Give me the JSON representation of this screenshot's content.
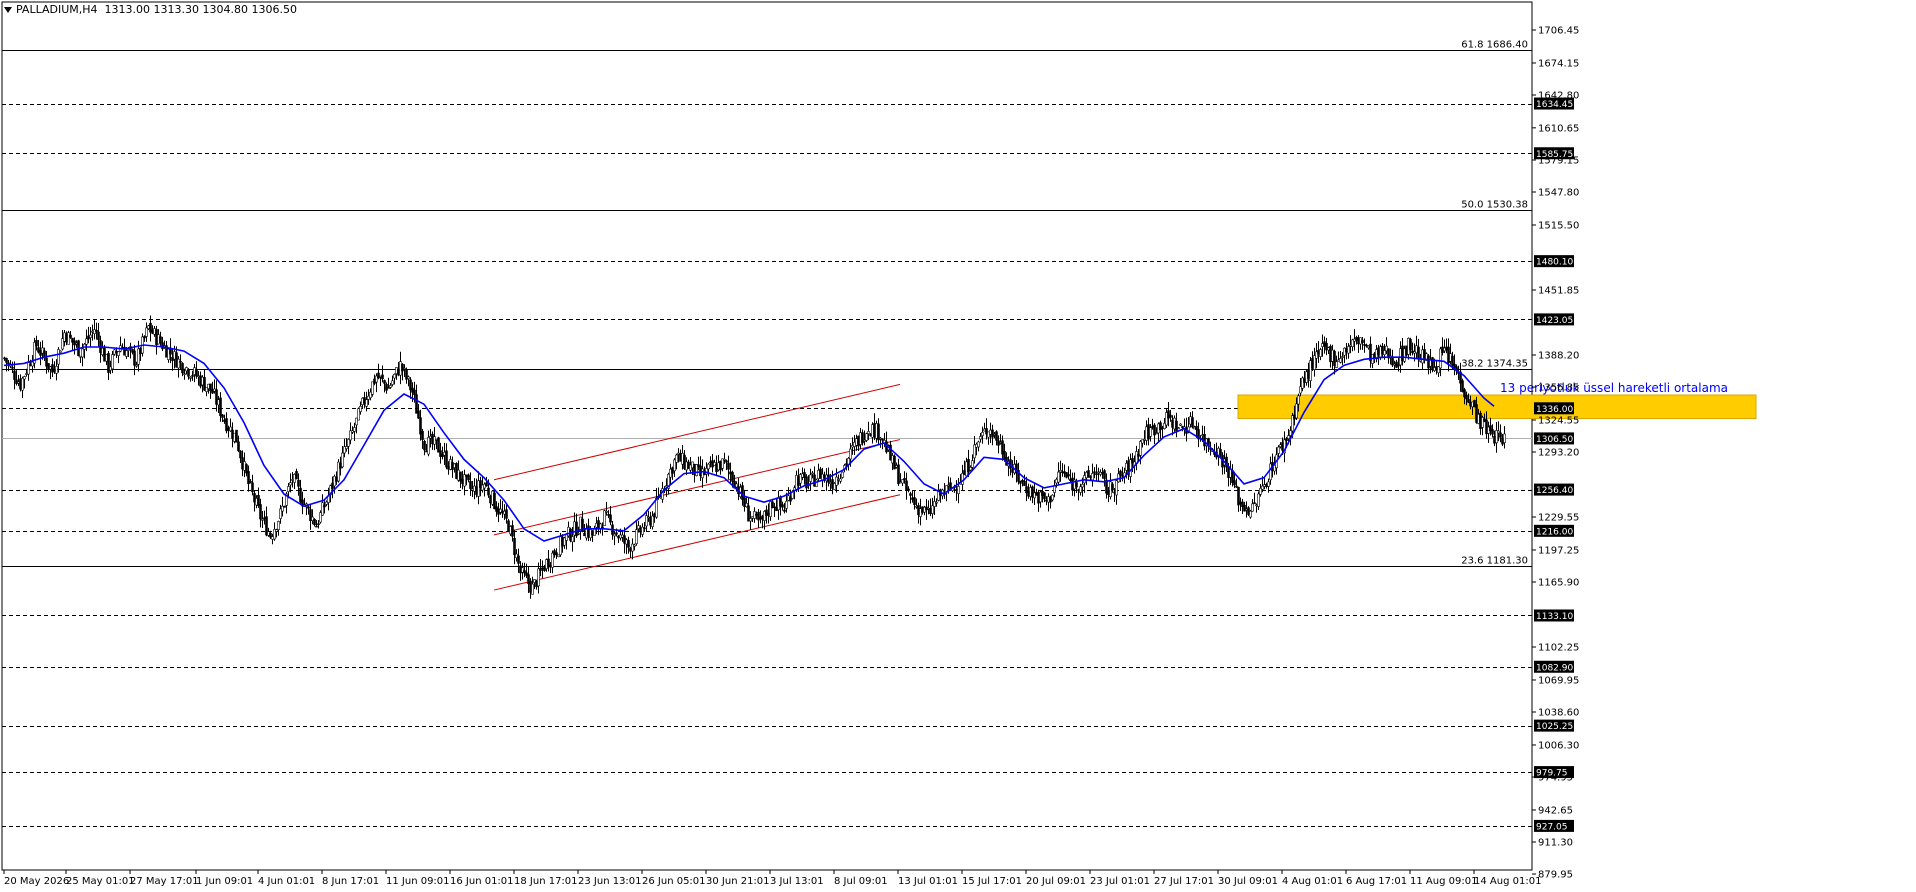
{
  "header": {
    "symbol": "PALLADIUM,H4",
    "ohlc": "1313.00 1313.30 1304.80 1306.50"
  },
  "colors": {
    "background": "#ffffff",
    "candle": "#000000",
    "ema": "#0000ff",
    "channel": "#cc0000",
    "zone": "#ffcc00",
    "level": "#000000",
    "label_box": "#000000",
    "label_text": "#ffffff"
  },
  "chart_data": {
    "type": "candlestick",
    "symbol": "PALLADIUM",
    "timeframe": "H4",
    "y_range": [
      879.95,
      1706.45
    ],
    "x_labels": [
      "20 May 2026",
      "25 May 01:01",
      "27 May 17:01",
      "1 Jun 09:01",
      "4 Jun 01:01",
      "8 Jun 17:01",
      "11 Jun 09:01",
      "16 Jun 01:01",
      "18 Jun 17:01",
      "23 Jun 13:01",
      "26 Jun 05:01",
      "30 Jun 21:01",
      "3 Jul 13:01",
      "8 Jul 09:01",
      "13 Jul 01:01",
      "15 Jul 17:01",
      "20 Jul 09:01",
      "23 Jul 01:01",
      "27 Jul 17:01",
      "30 Jul 09:01",
      "4 Aug 01:01",
      "6 Aug 17:01",
      "11 Aug 09:01",
      "14 Aug 01:01"
    ],
    "y_ticks": [
      "1706.45",
      "1674.15",
      "1642.80",
      "1610.65",
      "1579.15",
      "1547.80",
      "1515.50",
      "1451.85",
      "1388.20",
      "1356.85",
      "1324.55",
      "1293.20",
      "1229.55",
      "1197.25",
      "1165.90",
      "1102.25",
      "1069.95",
      "1038.60",
      "1006.30",
      "974.95",
      "942.65",
      "911.30",
      "879.95"
    ],
    "horizontal_levels": [
      "1634.45",
      "1585.75",
      "1480.10",
      "1423.05",
      "1336.00",
      "1256.40",
      "1216.00",
      "1133.10",
      "1082.90",
      "1025.25",
      "979.75",
      "927.05"
    ],
    "current_price": "1306.50",
    "fibonacci": [
      {
        "ratio": "61.8",
        "price": "1686.40"
      },
      {
        "ratio": "50.0",
        "price": "1530.38"
      },
      {
        "ratio": "38.2",
        "price": "1374.35"
      },
      {
        "ratio": "23.6",
        "price": "1181.30"
      }
    ],
    "ema_label": "13 periyotluk üssel hareketli ortalama",
    "zone": [
      1326,
      1349
    ],
    "price_path": [
      [
        0,
        1385
      ],
      [
        8,
        1360
      ],
      [
        16,
        1398
      ],
      [
        24,
        1372
      ],
      [
        30,
        1410
      ],
      [
        38,
        1392
      ],
      [
        45,
        1414
      ],
      [
        52,
        1376
      ],
      [
        58,
        1398
      ],
      [
        66,
        1382
      ],
      [
        72,
        1415
      ],
      [
        80,
        1396
      ],
      [
        88,
        1380
      ],
      [
        96,
        1368
      ],
      [
        104,
        1352
      ],
      [
        110,
        1325
      ],
      [
        116,
        1306
      ],
      [
        122,
        1262
      ],
      [
        128,
        1230
      ],
      [
        133,
        1212
      ],
      [
        138,
        1232
      ],
      [
        144,
        1268
      ],
      [
        150,
        1242
      ],
      [
        156,
        1222
      ],
      [
        162,
        1250
      ],
      [
        168,
        1283
      ],
      [
        174,
        1312
      ],
      [
        180,
        1344
      ],
      [
        186,
        1368
      ],
      [
        192,
        1356
      ],
      [
        198,
        1378
      ],
      [
        204,
        1352
      ],
      [
        210,
        1302
      ],
      [
        216,
        1300
      ],
      [
        222,
        1282
      ],
      [
        228,
        1268
      ],
      [
        234,
        1255
      ],
      [
        240,
        1262
      ],
      [
        246,
        1240
      ],
      [
        252,
        1222
      ],
      [
        258,
        1175
      ],
      [
        264,
        1160
      ],
      [
        270,
        1182
      ],
      [
        276,
        1198
      ],
      [
        282,
        1212
      ],
      [
        288,
        1222
      ],
      [
        294,
        1212
      ],
      [
        300,
        1230
      ],
      [
        306,
        1214
      ],
      [
        312,
        1200
      ],
      [
        318,
        1216
      ],
      [
        324,
        1230
      ],
      [
        330,
        1262
      ],
      [
        336,
        1288
      ],
      [
        342,
        1280
      ],
      [
        348,
        1270
      ],
      [
        354,
        1278
      ],
      [
        360,
        1282
      ],
      [
        366,
        1262
      ],
      [
        372,
        1232
      ],
      [
        378,
        1222
      ],
      [
        384,
        1244
      ],
      [
        390,
        1238
      ],
      [
        396,
        1268
      ],
      [
        402,
        1262
      ],
      [
        408,
        1272
      ],
      [
        414,
        1264
      ],
      [
        420,
        1280
      ],
      [
        426,
        1302
      ],
      [
        432,
        1318
      ],
      [
        438,
        1312
      ],
      [
        444,
        1282
      ],
      [
        450,
        1258
      ],
      [
        456,
        1240
      ],
      [
        462,
        1232
      ],
      [
        468,
        1252
      ],
      [
        474,
        1258
      ],
      [
        480,
        1272
      ],
      [
        486,
        1300
      ],
      [
        492,
        1318
      ],
      [
        498,
        1300
      ],
      [
        504,
        1276
      ],
      [
        510,
        1260
      ],
      [
        516,
        1250
      ],
      [
        522,
        1245
      ],
      [
        528,
        1275
      ],
      [
        534,
        1262
      ],
      [
        540,
        1264
      ],
      [
        546,
        1276
      ],
      [
        552,
        1254
      ],
      [
        558,
        1268
      ],
      [
        564,
        1282
      ],
      [
        570,
        1310
      ],
      [
        576,
        1318
      ],
      [
        582,
        1326
      ],
      [
        588,
        1316
      ],
      [
        594,
        1322
      ],
      [
        600,
        1304
      ],
      [
        606,
        1296
      ],
      [
        612,
        1276
      ],
      [
        618,
        1242
      ],
      [
        624,
        1236
      ],
      [
        630,
        1262
      ],
      [
        636,
        1290
      ],
      [
        642,
        1310
      ],
      [
        648,
        1356
      ],
      [
        654,
        1380
      ],
      [
        660,
        1394
      ],
      [
        666,
        1384
      ],
      [
        672,
        1396
      ],
      [
        678,
        1404
      ],
      [
        684,
        1384
      ],
      [
        690,
        1392
      ],
      [
        696,
        1382
      ],
      [
        702,
        1398
      ],
      [
        708,
        1388
      ],
      [
        714,
        1376
      ],
      [
        720,
        1392
      ],
      [
        726,
        1372
      ],
      [
        732,
        1346
      ],
      [
        738,
        1322
      ],
      [
        744,
        1310
      ],
      [
        750,
        1306
      ]
    ],
    "ema_path": [
      [
        0,
        1378
      ],
      [
        10,
        1380
      ],
      [
        20,
        1386
      ],
      [
        30,
        1390
      ],
      [
        40,
        1396
      ],
      [
        50,
        1396
      ],
      [
        60,
        1394
      ],
      [
        70,
        1398
      ],
      [
        80,
        1396
      ],
      [
        90,
        1392
      ],
      [
        100,
        1380
      ],
      [
        110,
        1356
      ],
      [
        120,
        1322
      ],
      [
        130,
        1280
      ],
      [
        140,
        1252
      ],
      [
        150,
        1240
      ],
      [
        160,
        1246
      ],
      [
        170,
        1266
      ],
      [
        180,
        1300
      ],
      [
        190,
        1334
      ],
      [
        200,
        1350
      ],
      [
        210,
        1340
      ],
      [
        220,
        1312
      ],
      [
        230,
        1286
      ],
      [
        240,
        1268
      ],
      [
        250,
        1246
      ],
      [
        260,
        1218
      ],
      [
        270,
        1206
      ],
      [
        280,
        1212
      ],
      [
        290,
        1218
      ],
      [
        300,
        1218
      ],
      [
        310,
        1216
      ],
      [
        320,
        1232
      ],
      [
        330,
        1256
      ],
      [
        340,
        1272
      ],
      [
        350,
        1274
      ],
      [
        360,
        1268
      ],
      [
        370,
        1250
      ],
      [
        380,
        1244
      ],
      [
        390,
        1250
      ],
      [
        400,
        1260
      ],
      [
        410,
        1266
      ],
      [
        420,
        1276
      ],
      [
        430,
        1296
      ],
      [
        440,
        1302
      ],
      [
        450,
        1284
      ],
      [
        460,
        1262
      ],
      [
        470,
        1252
      ],
      [
        480,
        1266
      ],
      [
        490,
        1288
      ],
      [
        500,
        1286
      ],
      [
        510,
        1268
      ],
      [
        520,
        1258
      ],
      [
        530,
        1262
      ],
      [
        540,
        1266
      ],
      [
        550,
        1264
      ],
      [
        560,
        1268
      ],
      [
        570,
        1290
      ],
      [
        580,
        1308
      ],
      [
        590,
        1316
      ],
      [
        600,
        1304
      ],
      [
        610,
        1284
      ],
      [
        620,
        1262
      ],
      [
        630,
        1268
      ],
      [
        640,
        1294
      ],
      [
        650,
        1332
      ],
      [
        660,
        1364
      ],
      [
        670,
        1378
      ],
      [
        680,
        1384
      ],
      [
        690,
        1386
      ],
      [
        700,
        1386
      ],
      [
        710,
        1384
      ],
      [
        720,
        1382
      ],
      [
        730,
        1368
      ],
      [
        740,
        1346
      ],
      [
        745,
        1338
      ]
    ],
    "channel": {
      "start_index": 245,
      "end_index": 448,
      "start_mid": 1212,
      "slope_per_bar": 0.46,
      "half_width": 54
    }
  }
}
